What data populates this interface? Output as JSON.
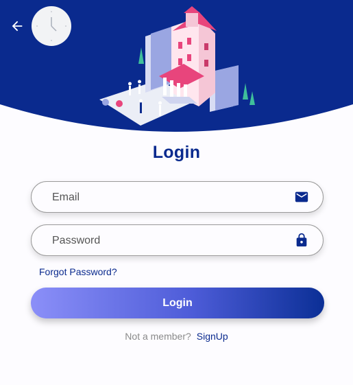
{
  "page": {
    "title": "Login"
  },
  "form": {
    "email_placeholder": "Email",
    "password_placeholder": "Password",
    "forgot_password": "Forgot Password?",
    "login_button": "Login"
  },
  "footer": {
    "prompt": "Not a member?",
    "signup_link": "SignUp"
  },
  "icons": {
    "back": "arrow-left-icon",
    "clock": "clock-icon",
    "email": "mail-icon",
    "password": "lock-icon"
  },
  "colors": {
    "primary": "#0a2a8e",
    "accent": "#e8457c",
    "gradient_start": "#8b8ff8",
    "gradient_end": "#0b2f96"
  }
}
